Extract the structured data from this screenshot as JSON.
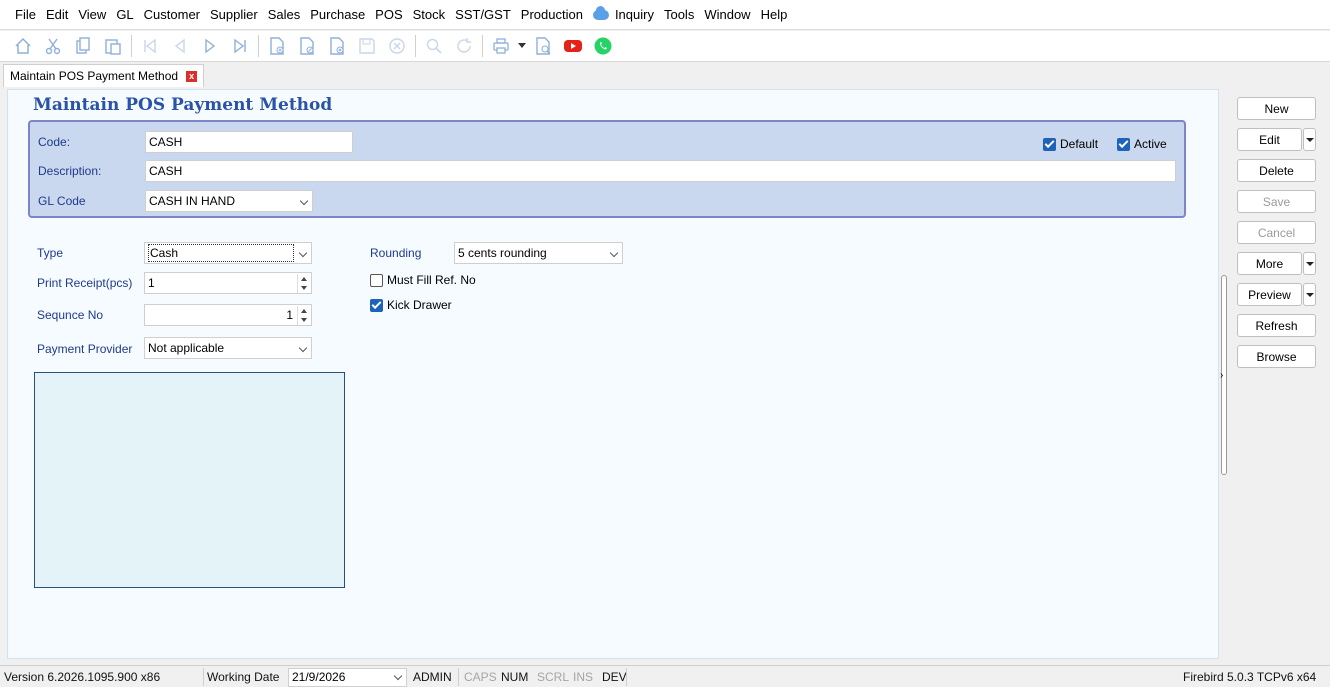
{
  "menu": [
    "File",
    "Edit",
    "View",
    "GL",
    "Customer",
    "Supplier",
    "Sales",
    "Purchase",
    "POS",
    "Stock",
    "SST/GST",
    "Production",
    "Inquiry",
    "Tools",
    "Window",
    "Help"
  ],
  "toolbar": {
    "icons": [
      "home-icon",
      "cut-icon",
      "copy-icon",
      "paste-icon",
      "first-record-icon",
      "prior-record-icon",
      "next-record-icon",
      "last-record-icon",
      "new-document-icon",
      "edit-document-icon",
      "delete-document-icon",
      "save-icon",
      "cancel-icon",
      "search-icon",
      "refresh-icon",
      "print-icon",
      "print-preview-icon",
      "youtube-icon",
      "whatsapp-icon"
    ]
  },
  "tab": {
    "title": "Maintain POS Payment Method",
    "close": "x"
  },
  "form": {
    "title": "Maintain POS Payment Method",
    "code_label": "Code:",
    "code_value": "CASH",
    "description_label": "Description:",
    "description_value": "CASH",
    "glcode_label": "GL Code",
    "glcode_value": "CASH IN HAND",
    "default_label": "Default",
    "default_checked": true,
    "active_label": "Active",
    "active_checked": true,
    "type_label": "Type",
    "type_value": "Cash",
    "print_receipt_label": "Print Receipt(pcs)",
    "print_receipt_value": "1",
    "sequence_label": "Sequnce No",
    "sequence_value": "1",
    "payment_provider_label": "Payment Provider",
    "payment_provider_value": "Not applicable",
    "rounding_label": "Rounding",
    "rounding_value": "5 cents rounding",
    "must_fill_label": "Must Fill Ref. No",
    "must_fill_checked": false,
    "kick_drawer_label": "Kick Drawer",
    "kick_drawer_checked": true
  },
  "side_buttons": {
    "new": "New",
    "edit": "Edit",
    "delete": "Delete",
    "save": "Save",
    "cancel": "Cancel",
    "more": "More",
    "preview": "Preview",
    "refresh": "Refresh",
    "browse": "Browse"
  },
  "status": {
    "version": "Version 6.2026.1095.900 x86",
    "working_date_label": "Working Date",
    "working_date": "21/9/2026",
    "user": "ADMIN",
    "caps": "CAPS",
    "num": "NUM",
    "scrl": "SCRL",
    "ins": "INS",
    "dev": "DEV",
    "db": "Firebird 5.0.3 TCPv6 x64"
  },
  "colors": {
    "accent": "#2a52a6",
    "header_panel": "#c9d8ee",
    "checkbox": "#1f62b9",
    "youtube": "#e62117",
    "whatsapp": "#25d366"
  }
}
